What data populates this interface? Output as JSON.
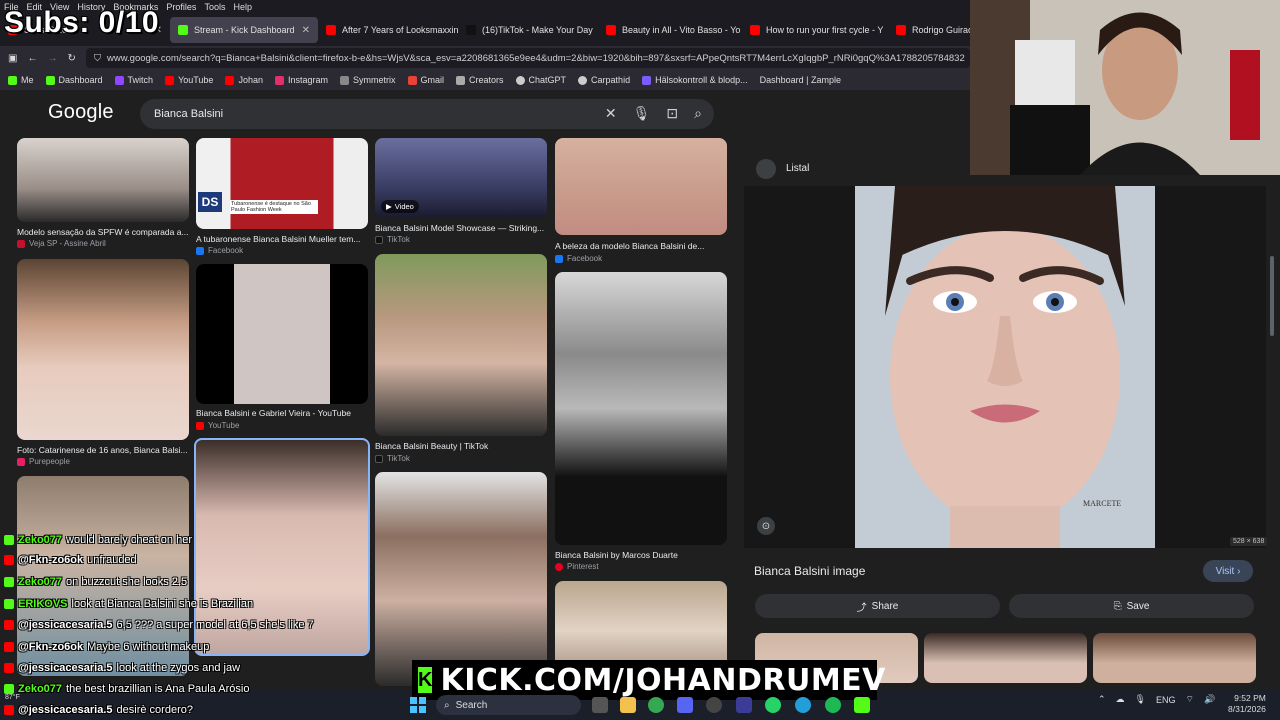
{
  "menubar": [
    "File",
    "Edit",
    "View",
    "History",
    "Bookmarks",
    "Profiles",
    "Tools",
    "Help"
  ],
  "tabs": [
    {
      "label": "Subs: 0/10",
      "color": "#ff0000",
      "active": false
    },
    {
      "label": "Stream - Kick Dashboard",
      "color": "#53fc18",
      "active": false
    },
    {
      "label": "After 7 Years of Looksmaxxing",
      "color": "#ff0000",
      "active": false
    },
    {
      "label": "(16)TikTok - Make Your Day",
      "color": "#111111",
      "active": false
    },
    {
      "label": "Beauty in All - Vito Basso - Yo",
      "color": "#ff0000",
      "active": false
    },
    {
      "label": "How to run your first cycle - Y",
      "color": "#ff0000",
      "active": false
    },
    {
      "label": "Rodrigo Guirao",
      "color": "#ff0000",
      "active": false
    }
  ],
  "url": "www.google.com/search?q=Bianca+Balsini&client=firefox-b-e&hs=WjsV&sca_esv=a2208681365e9ee4&udm=2&biw=1920&bih=897&sxsrf=APpeQntsRT7M4errLcXgIqgbP_rNRi0gqQ%3A1788205784832",
  "bookmarks": [
    {
      "label": "Me",
      "color": "#53fc18"
    },
    {
      "label": "Dashboard",
      "color": "#53fc18"
    },
    {
      "label": "Twitch",
      "color": "#9146ff"
    },
    {
      "label": "YouTube",
      "color": "#ff0000"
    },
    {
      "label": "Johan",
      "color": "#ff0000"
    },
    {
      "label": "Instagram",
      "color": "#e1306c"
    },
    {
      "label": "Symmetrix",
      "color": "#888888"
    },
    {
      "label": "Gmail",
      "color": "#ea4335"
    },
    {
      "label": "Creators",
      "color": "#aaaaaa"
    },
    {
      "label": "ChatGPT",
      "color": "#cccccc"
    },
    {
      "label": "Carpathid",
      "color": "#cccccc"
    },
    {
      "label": "Hälsokontroll & blodp...",
      "color": "#7b5cff"
    },
    {
      "label": "Dashboard | Zample",
      "color": "#2b2a33"
    }
  ],
  "google": {
    "logo": "Google",
    "query": "Bianca Balsini"
  },
  "results": [
    {
      "caption": "Modelo sensação da SPFW é comparada a...",
      "source": "Veja SP - Assine Abril",
      "src_color": "#c8102e"
    },
    {
      "caption": "A tubaronense Bianca Balsini Mueller tem...",
      "source": "Facebook",
      "src_color": "#1877f2",
      "overlay": "Tubaronense é destaque no São Paulo Fashion Week",
      "badge": "DS"
    },
    {
      "caption": "Bianca Balsini Model Showcase — Striking...",
      "source": "TikTok",
      "src_color": "#111111",
      "video": "Video"
    },
    {
      "caption": "A beleza da modelo Bianca Balsini de...",
      "source": "Facebook",
      "src_color": "#1877f2"
    },
    {
      "caption": "Foto: Catarinense de 16 anos, Bianca Balsi...",
      "source": "Purepeople",
      "src_color": "#e91e63"
    },
    {
      "caption": "Bianca Balsini e Gabriel Vieira - YouTube",
      "source": "YouTube",
      "src_color": "#ff0000"
    },
    {
      "caption": "Bianca Balsini Beauty | TikTok",
      "source": "TikTok",
      "src_color": "#111111"
    },
    {
      "caption": "Bianca Balsini by Marcos Duarte",
      "source": "Pinterest",
      "src_color": "#e60023"
    }
  ],
  "panel": {
    "source": "Listal",
    "title": "Bianca Balsini image",
    "visit": "Visit",
    "share": "Share",
    "save": "Save",
    "dims": "528 × 638",
    "watermark": "MARCETE"
  },
  "overlay": {
    "subs": "Subs: 0/10",
    "kick": "KICK.COM/JOHANDRUMEV",
    "status_url": "www.listal.com/viewimage/26778291"
  },
  "chat": [
    {
      "user": "Zeko077",
      "msg": "would barely cheat on her",
      "platform": "kick"
    },
    {
      "user": "@Fkn-zo6ok",
      "msg": "unfrauded",
      "platform": "youtube"
    },
    {
      "user": "Zeko077",
      "msg": "on buzzcut she looks 2.5",
      "platform": "kick"
    },
    {
      "user": "ERIKOVS",
      "msg": "look at Bianca Balsini she is Brazilian",
      "platform": "kick"
    },
    {
      "user": "@jessicacesaria.5",
      "msg": "6,5 ??? a super model at 6,5 she's like 7",
      "platform": "youtube"
    },
    {
      "user": "@Fkn-zo6ok",
      "msg": "Maybe 6 without makeup",
      "platform": "youtube"
    },
    {
      "user": "@jessicacesaria.5",
      "msg": "look at the zygos and jaw",
      "platform": "youtube"
    },
    {
      "user": "Zeko077",
      "msg": "the best brazillian is Ana Paula Arósio",
      "platform": "kick"
    },
    {
      "user": "@jessicacesaria.5",
      "msg": "desirè cordero?",
      "platform": "youtube"
    }
  ],
  "taskbar": {
    "search": "Search",
    "lang": "ENG",
    "time": "9:52 PM",
    "date": "8/31/2026",
    "weather": "87°F"
  },
  "colors": {
    "kick_green": "#53fc18",
    "youtube_red": "#ff0000",
    "google_bg": "#1f1f1f"
  }
}
